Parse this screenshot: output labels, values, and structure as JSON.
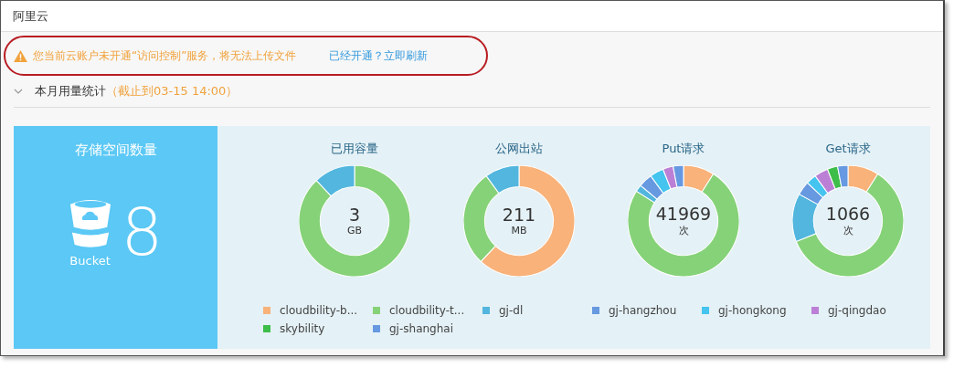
{
  "window": {
    "title": "阿里云"
  },
  "warning": {
    "message": "您当前云账户未开通“访问控制”服务，将无法上传文件",
    "link": "已经开通？立即刷新"
  },
  "section": {
    "title": "本月用量统计",
    "note": "（截止到03-15 14:00）",
    "expanded": true
  },
  "storage": {
    "title": "存储空间数量",
    "label": "Bucket",
    "count": "8"
  },
  "donuts": [
    {
      "title": "已用容量",
      "value": "3",
      "unit": "GB",
      "kind": "picture"
    },
    {
      "title": "公网出站",
      "value": "211",
      "unit": "MB",
      "kind": "picture"
    },
    {
      "title": "Put请求",
      "value": "41969",
      "unit": "次",
      "kind": "picture"
    },
    {
      "title": "Get请求",
      "value": "1066",
      "unit": "次",
      "kind": "picture"
    }
  ],
  "legend": [
    {
      "label": "cloudbility-b...",
      "color": "#f8b27a"
    },
    {
      "label": "cloudbility-t...",
      "color": "#86d279"
    },
    {
      "label": "gj-dl",
      "color": "#52b6de"
    },
    {
      "label": "gj-hangzhou",
      "color": "#6699e0"
    },
    {
      "label": "gj-hongkong",
      "color": "#44c4ee"
    },
    {
      "label": "gj-qingdao",
      "color": "#bb80d6"
    },
    {
      "label": "skybility",
      "color": "#3dbd4a"
    },
    {
      "label": "gj-shanghai",
      "color": "#6699e1"
    }
  ]
}
